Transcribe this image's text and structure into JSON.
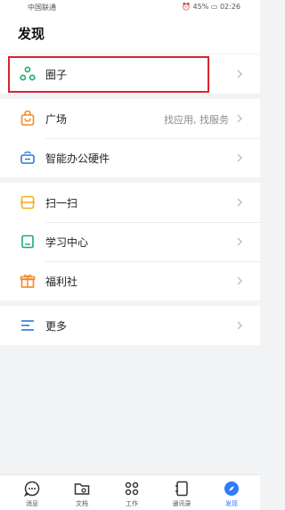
{
  "status_bar": {
    "carrier": "中国联通",
    "battery": "45%",
    "time": "02:26"
  },
  "header": {
    "title": "发现"
  },
  "items": {
    "circle": {
      "label": "圈子"
    },
    "plaza": {
      "label": "广场",
      "subtitle": "找应用, 找服务"
    },
    "hardware": {
      "label": "智能办公硬件"
    },
    "scan": {
      "label": "扫一扫"
    },
    "learning": {
      "label": "学习中心"
    },
    "welfare": {
      "label": "福利社"
    },
    "more": {
      "label": "更多"
    }
  },
  "bottom_nav": {
    "messages": "消息",
    "docs": "文档",
    "work": "工作",
    "contacts": "通讯录",
    "discover": "发现"
  },
  "colors": {
    "accent": "#2f7cf6",
    "highlight": "#d9232d",
    "green": "#1aad6f",
    "orange": "#f08a24",
    "yellow": "#f2b01e",
    "blue": "#2a7ad6"
  }
}
